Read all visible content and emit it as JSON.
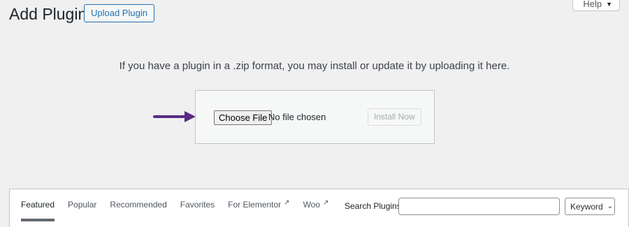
{
  "header": {
    "title": "Add Plugins",
    "upload_button": "Upload Plugin",
    "help_label": "Help",
    "help_caret": "▼"
  },
  "upload": {
    "help_text": "If you have a plugin in a .zip format, you may install or update it by uploading it here.",
    "choose_file_label": "Choose File",
    "file_status": "No file chosen",
    "install_label": "Install Now"
  },
  "filter": {
    "tabs": [
      {
        "label": "Featured",
        "current": true
      },
      {
        "label": "Popular"
      },
      {
        "label": "Recommended"
      },
      {
        "label": "Favorites"
      },
      {
        "label": "For Elementor",
        "external": true
      },
      {
        "label": "Woo",
        "external": true
      }
    ],
    "external_icon": "external-link-icon",
    "search_label": "Search Plugins",
    "search_value": "",
    "select_value": "Keyword"
  },
  "colors": {
    "accent": "#2271b1",
    "arrow": "#5b2c83",
    "background": "#f0f0f1"
  }
}
